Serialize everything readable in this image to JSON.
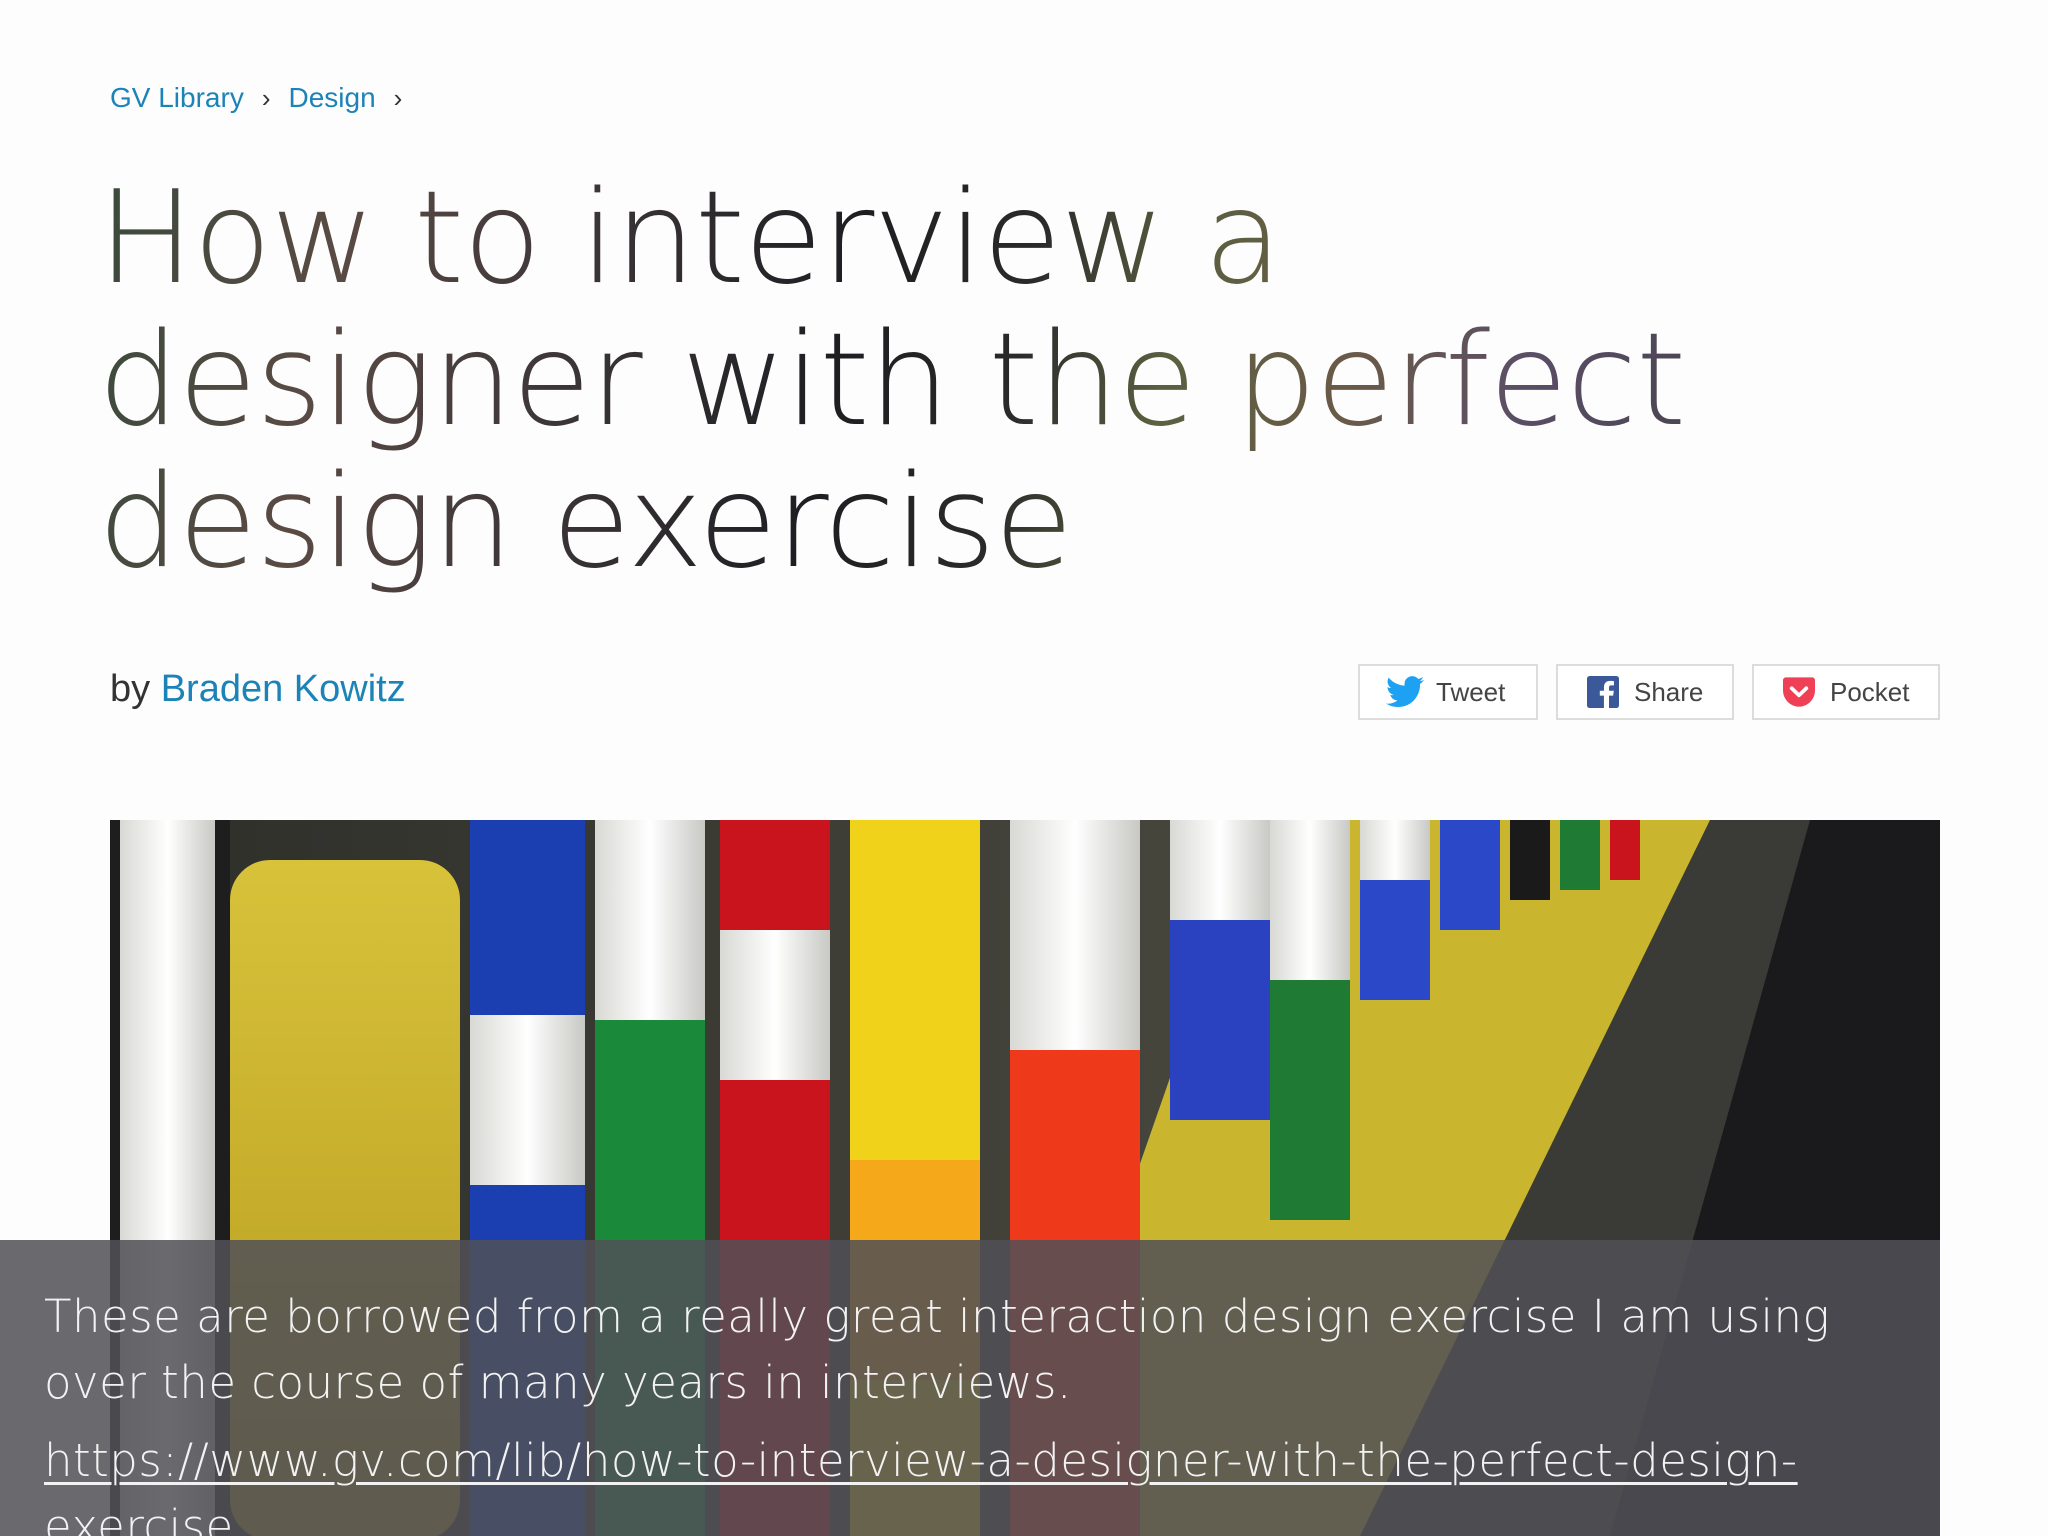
{
  "breadcrumb": {
    "items": [
      "GV Library",
      "Design"
    ],
    "separator": "›"
  },
  "article": {
    "title": "How to interview a designer with the perfect design exercise",
    "byline_prefix": "by",
    "author": "Braden Kowitz"
  },
  "share": {
    "tweet_label": "Tweet",
    "share_label": "Share",
    "pocket_label": "Pocket"
  },
  "hero": {
    "icon": "markers-photo"
  },
  "caption": {
    "text": "These are borrowed from a really great interaction design exercise I am using over the course of many years in interviews.",
    "link": "https://www.gv.com/lib/how-to-interview-a-designer-with-the-perfect-design-exercise"
  },
  "colors": {
    "link_blue": "#1c83b8",
    "twitter_blue": "#1da1f2",
    "facebook_blue": "#3b5998",
    "pocket_red": "#ef4056",
    "caption_bg": "#505056"
  }
}
